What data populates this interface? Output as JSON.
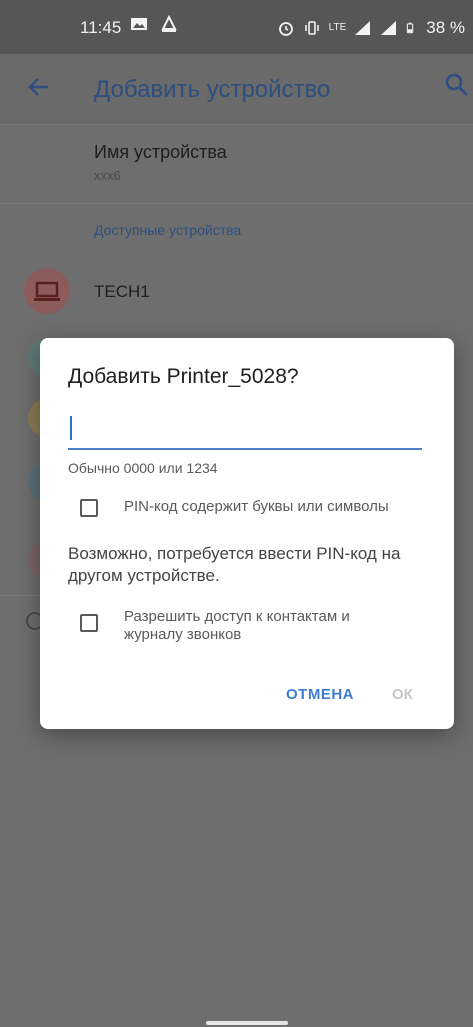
{
  "status_bar": {
    "time": "11:45",
    "battery": "38 %",
    "network_label": "LTE",
    "icons": [
      "image-notification-icon",
      "cast-icon",
      "alarm-icon",
      "vibrate-icon",
      "lte-icon",
      "signal-icon",
      "signal-icon",
      "battery-icon"
    ]
  },
  "app_bar": {
    "title": "Добавить устройство",
    "back_icon": "arrow-left-icon",
    "search_icon": "search-icon"
  },
  "background_list": {
    "device_name_label": "Имя устройства",
    "device_name_value": "xxx6",
    "section_header": "Доступные устройства",
    "items": [
      {
        "label": "TECH1",
        "icon": "laptop-icon"
      }
    ]
  },
  "dialog": {
    "title": "Добавить Printer_5028?",
    "pin_input_value": "",
    "hint": "Обычно 0000 или 1234",
    "checkbox_alnum_label": "PIN-код содержит буквы или символы",
    "checkbox_alnum_checked": false,
    "info": "Возможно, потребуется ввести PIN-код на другом устройстве.",
    "checkbox_contacts_label": "Разрешить доступ к контактам и журналу звонков",
    "checkbox_contacts_checked": false,
    "cancel_label": "ОТМЕНА",
    "ok_label": "ОК"
  },
  "colors": {
    "accent": "#3e7bd6",
    "title_blue": "#2c4f80",
    "scrim": "#6e6e6e"
  }
}
